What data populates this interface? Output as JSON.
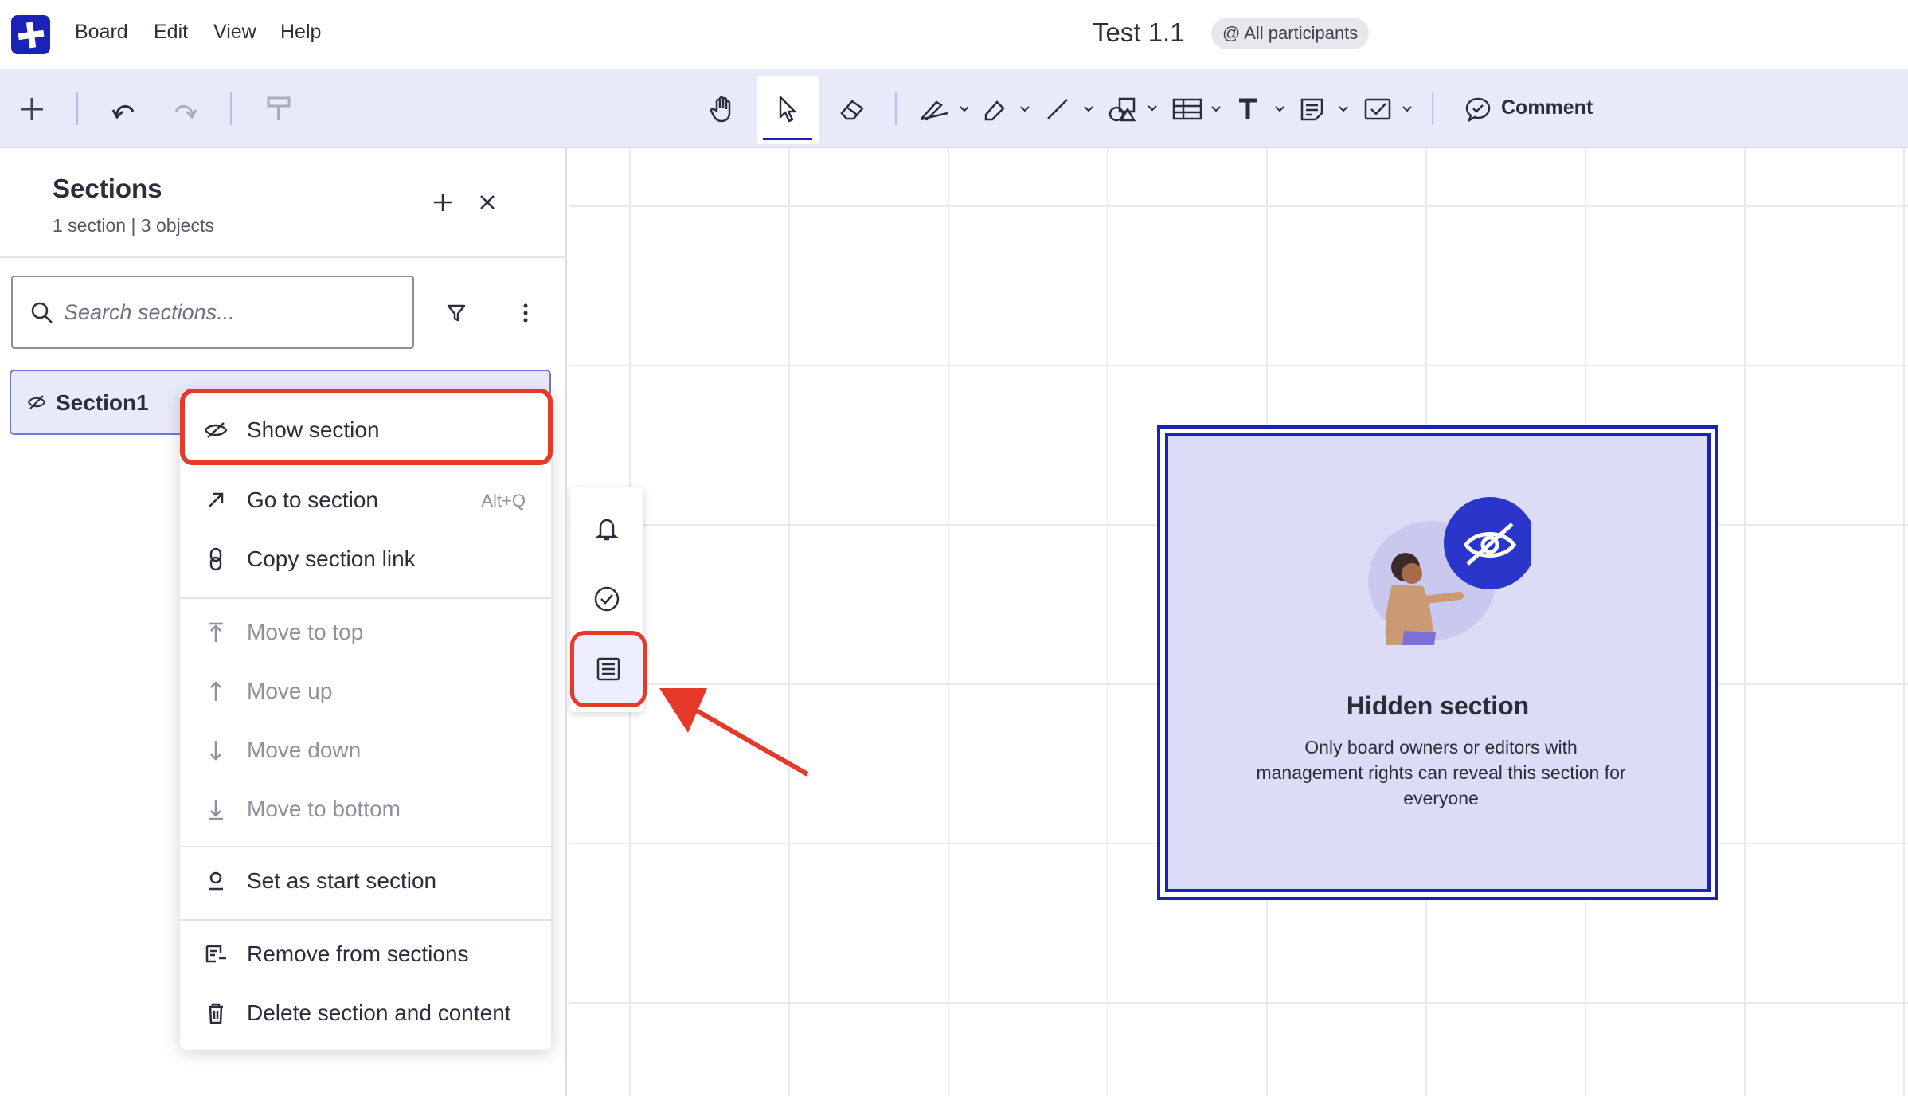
{
  "menubar": {
    "items": [
      "Board",
      "Edit",
      "View",
      "Help"
    ],
    "board_title": "Test 1.1",
    "participants": "@ All participants"
  },
  "toolbar": {
    "comment_label": "Comment",
    "icons": [
      "plus-icon",
      "undo-icon",
      "redo-icon",
      "format-painter-icon",
      "hand-icon",
      "pointer-icon",
      "eraser-icon",
      "pen-icon",
      "highlighter-icon",
      "line-icon",
      "shapes-icon",
      "table-icon",
      "text-icon",
      "sticky-note-icon",
      "checkbox-icon",
      "comment-icon"
    ]
  },
  "sections_panel": {
    "title": "Sections",
    "subtitle": "1 section | 3 objects",
    "search_placeholder": "Search sections...",
    "section_name": "Section1"
  },
  "context_menu": {
    "show_section": "Show section",
    "go_to_section": "Go to section",
    "go_to_shortcut": "Alt+Q",
    "copy_link": "Copy section link",
    "move_to_top": "Move to top",
    "move_up": "Move up",
    "move_down": "Move down",
    "move_to_bottom": "Move to bottom",
    "set_start": "Set as start section",
    "remove": "Remove from sections",
    "delete": "Delete section and content"
  },
  "hidden_section": {
    "title": "Hidden section",
    "description": "Only board owners or editors with management rights can reveal this section for everyone"
  },
  "colors": {
    "brand": "#1b22b8",
    "toolbar_bg": "#e9eaf9",
    "highlight": "#e53a2a",
    "hidden_card_bg": "#dcdcf6"
  }
}
